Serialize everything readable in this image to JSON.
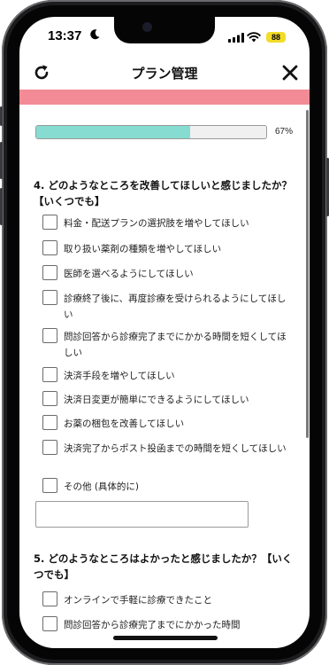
{
  "status_bar": {
    "time": "13:37",
    "battery": "88",
    "battery_color": "#f2dc2a"
  },
  "header": {
    "title": "プラン管理",
    "left_icon": "reload-icon",
    "right_icon": "close-icon"
  },
  "colors": {
    "band": "#f28b96",
    "progress_fill": "#86dcd1",
    "progress_track": "#f0f0f0"
  },
  "progress": {
    "fraction": 0.67,
    "label": "67%"
  },
  "question4": {
    "text": "4. どのようなところを改善してほしいと感じましたか？【いくつでも】",
    "options": [
      "料金・配送プランの選択肢を増やしてほしい",
      "取り扱い薬剤の種類を増やしてほしい",
      "医師を選べるようにしてほしい",
      "診療終了後に、再度診療を受けられるようにしてほしい",
      "問診回答から診療完了までにかかる時間を短くしてほしい",
      "決済手段を増やしてほしい",
      "決済日変更が簡単にできるようにしてほしい",
      "お薬の梱包を改善してほしい",
      "決済完了からポスト投函までの時間を短くしてほしい",
      "その他 (具体的に)"
    ],
    "other_input_value": ""
  },
  "question5": {
    "text": "5. どのようなところはよかったと感じましたか？【いくつでも】",
    "options": [
      "オンラインで手軽に診療できたこと",
      "問診回答から診療完了までにかかった時間"
    ]
  }
}
